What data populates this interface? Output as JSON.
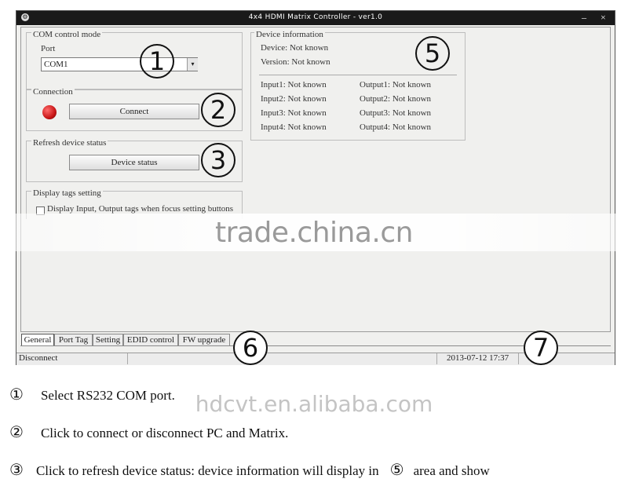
{
  "window": {
    "title": "4x4 HDMI Matrix Controller - ver1.0",
    "minimize_glyph": "–",
    "close_glyph": "×"
  },
  "com_group": {
    "label": "COM control mode",
    "port_label": "Port",
    "port_value": "COM1"
  },
  "connection_group": {
    "label": "Connection",
    "connect_button": "Connect",
    "led_color": "#c81616"
  },
  "refresh_group": {
    "label": "Refresh device status",
    "status_button": "Device status"
  },
  "tags_group": {
    "label": "Display tags setting",
    "checkbox_label": "Display Input, Output tags when focus setting buttons",
    "checked": false
  },
  "device_info": {
    "label": "Device information",
    "device": "Device: Not known",
    "version": "Version: Not known",
    "inputs": [
      "Input1: Not known",
      "Input2: Not known",
      "Input3: Not known",
      "Input4: Not known"
    ],
    "outputs": [
      "Output1: Not known",
      "Output2: Not known",
      "Output3: Not known",
      "Output4: Not known"
    ]
  },
  "tabs": [
    "General",
    "Port Tag",
    "Setting",
    "EDID control",
    "FW upgrade"
  ],
  "status_bar": {
    "left": "Disconnect",
    "datetime": "2013-07-12 17:37"
  },
  "callouts": [
    "1",
    "2",
    "3",
    "5",
    "6",
    "7"
  ],
  "watermarks": {
    "top": "trade.china.cn",
    "bottom": "hdcvt.en.alibaba.com"
  },
  "captions": [
    {
      "num": "①",
      "text": "Select RS232 COM port."
    },
    {
      "num": "②",
      "text": "Click to connect or disconnect PC and Matrix."
    },
    {
      "num": "③",
      "text": "Click to refresh device status: device information will display in"
    },
    {
      "num": "⑤",
      "text": "area and show"
    }
  ]
}
